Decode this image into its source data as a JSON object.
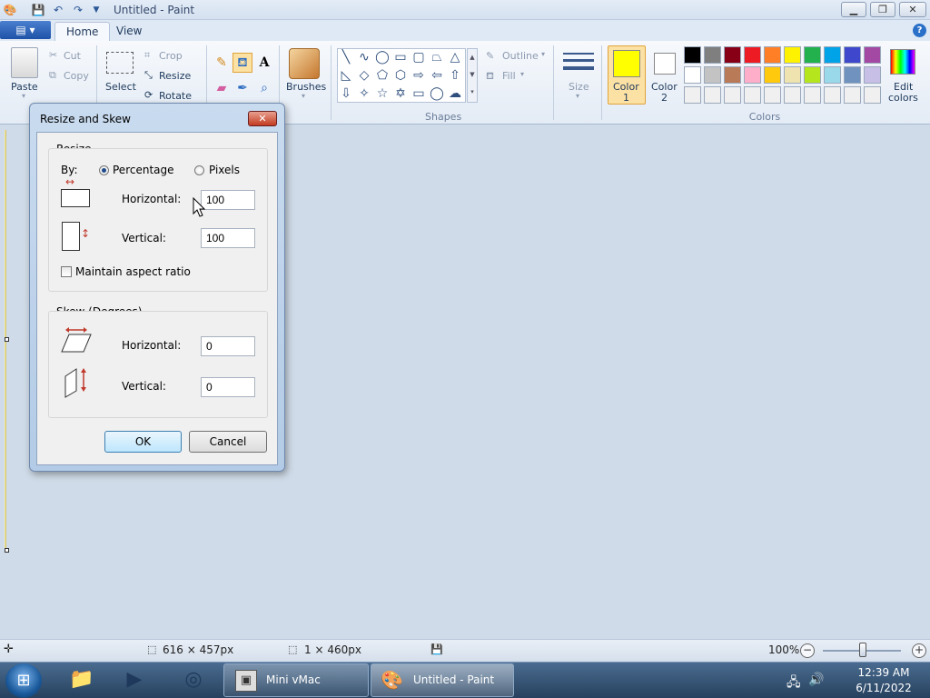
{
  "window": {
    "title": "Untitled - Paint"
  },
  "tabs": [
    {
      "label": "Home"
    },
    {
      "label": "View"
    }
  ],
  "ribbon": {
    "clipboard": {
      "paste": "Paste",
      "cut": "Cut",
      "copy": "Copy"
    },
    "image": {
      "select": "Select",
      "crop": "Crop",
      "resize": "Resize",
      "rotate": "Rotate"
    },
    "brushes": "Brushes",
    "shapes": {
      "label": "Shapes",
      "outline": "Outline",
      "fill": "Fill"
    },
    "size": "Size",
    "color1": {
      "line1": "Color",
      "line2": "1",
      "value": "#ffff00"
    },
    "color2": {
      "line1": "Color",
      "line2": "2",
      "value": "#ffffff"
    },
    "colors_label": "Colors",
    "edit_colors": {
      "line1": "Edit",
      "line2": "colors"
    },
    "palette_row1": [
      "#000000",
      "#7f7f7f",
      "#880015",
      "#ed1c24",
      "#ff7f27",
      "#fff200",
      "#22b14c",
      "#00a2e8",
      "#3f48cc",
      "#a349a4"
    ],
    "palette_row2": [
      "#ffffff",
      "#c3c3c3",
      "#b97a57",
      "#ffaec9",
      "#ffc90e",
      "#efe4b0",
      "#b5e61d",
      "#99d9ea",
      "#7092be",
      "#c8bfe7"
    ],
    "palette_row3": [
      "#f0f0f0",
      "#f0f0f0",
      "#f0f0f0",
      "#f0f0f0",
      "#f0f0f0",
      "#f0f0f0",
      "#f0f0f0",
      "#f0f0f0",
      "#f0f0f0",
      "#f0f0f0"
    ]
  },
  "dialog": {
    "title": "Resize and Skew",
    "close": "✕",
    "resize": {
      "heading": "Resize",
      "by_label": "By:",
      "percentage": "Percentage",
      "pixels": "Pixels",
      "horizontal_label": "Horizontal:",
      "horizontal_value": "100",
      "vertical_label": "Vertical:",
      "vertical_value": "100",
      "maintain": "Maintain aspect ratio"
    },
    "skew": {
      "heading": "Skew (Degrees)",
      "horizontal_label": "Horizontal:",
      "horizontal_value": "0",
      "vertical_label": "Vertical:",
      "vertical_value": "0"
    },
    "ok": "OK",
    "cancel": "Cancel"
  },
  "status": {
    "image_size": "616 × 457px",
    "selection_size": "1 × 460px",
    "zoom": "100%"
  },
  "taskbar": {
    "minivmac": "Mini vMac",
    "paint": "Untitled - Paint",
    "time": "12:39 AM",
    "date": "6/11/2022"
  }
}
